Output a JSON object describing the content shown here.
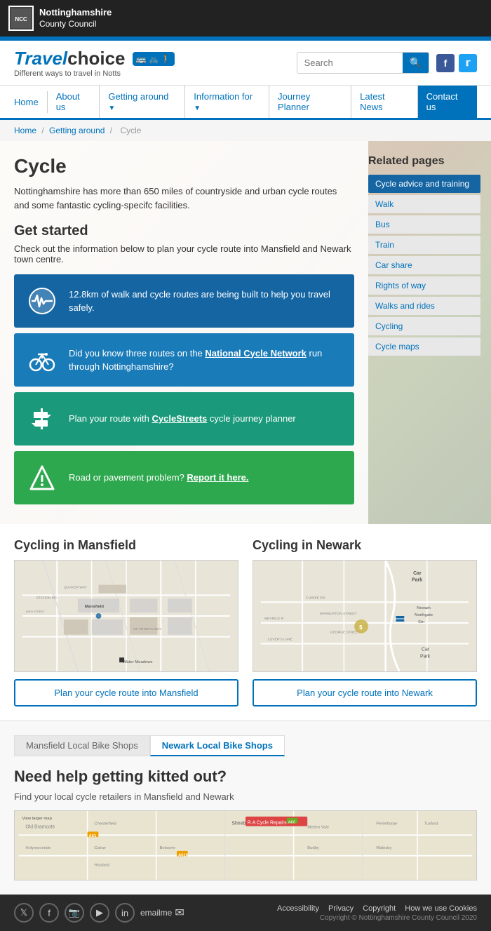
{
  "topBar": {
    "orgName": "Nottinghamshire",
    "orgName2": "County Council"
  },
  "logo": {
    "travelText": "Travel",
    "choiceText": "choice",
    "subtitle": "Different ways to travel in Notts"
  },
  "search": {
    "placeholder": "Search"
  },
  "nav": {
    "items": [
      {
        "label": "Home",
        "href": "#"
      },
      {
        "label": "About us",
        "href": "#"
      },
      {
        "label": "Getting around",
        "href": "#",
        "hasDropdown": true
      },
      {
        "label": "Information for",
        "href": "#",
        "hasDropdown": true
      },
      {
        "label": "Journey Planner",
        "href": "#"
      },
      {
        "label": "Latest News",
        "href": "#"
      },
      {
        "label": "Contact us",
        "href": "#",
        "isContact": true
      }
    ]
  },
  "breadcrumb": {
    "items": [
      "Home",
      "Getting around",
      "Cycle"
    ]
  },
  "page": {
    "title": "Cycle",
    "intro": "Nottinghamshire has more than 650 miles of countryside and urban cycle routes and some fantastic cycling-specifc facilities.",
    "getStartedTitle": "Get started",
    "getStartedText": "Check out the information below to plan your cycle route into Mansfield and Newark town centre."
  },
  "infoCards": [
    {
      "color": "blue",
      "icon": "heart-pulse",
      "text": "12.8km of walk and cycle routes are being built to help you travel safely."
    },
    {
      "color": "mid-blue",
      "icon": "bicycle",
      "text": "Did you know three routes on the National Cycle Network run through Nottinghamshire?",
      "linkText": "National Cycle Network"
    },
    {
      "color": "teal",
      "icon": "signpost",
      "text": "Plan your route with CycleStreets cycle journey planner",
      "linkText": "CycleStreets"
    },
    {
      "color": "green",
      "icon": "road",
      "text": "Road or pavement problem? Report it here.",
      "linkText": "Report it here."
    }
  ],
  "relatedPages": {
    "title": "Related pages",
    "items": [
      {
        "label": "Cycle advice and training",
        "active": true
      },
      {
        "label": "Walk"
      },
      {
        "label": "Bus"
      },
      {
        "label": "Train"
      },
      {
        "label": "Car share"
      },
      {
        "label": "Rights of way"
      },
      {
        "label": "Walks and rides"
      },
      {
        "label": "Cycling"
      },
      {
        "label": "Cycle maps"
      }
    ]
  },
  "mapSection": {
    "mansfield": {
      "title": "Cycling in Mansfield",
      "btnText": "Plan your cycle route into Mansfield"
    },
    "newark": {
      "title": "Cycling in Newark",
      "btnText": "Plan your cycle route into Newark"
    }
  },
  "bikeShops": {
    "tab1": "Mansfield Local Bike Shops",
    "tab2": "Newark Local Bike Shops",
    "title": "Need help getting kitted out?",
    "text": "Find your local cycle retailers in Mansfield and Newark"
  },
  "footer": {
    "links": [
      {
        "label": "Accessibility"
      },
      {
        "label": "Privacy"
      },
      {
        "label": "Copyright"
      },
      {
        "label": "How we use Cookies"
      }
    ],
    "copyright": "Copyright © Nottinghamshire County Council 2020",
    "emailLabel": "emailme"
  }
}
